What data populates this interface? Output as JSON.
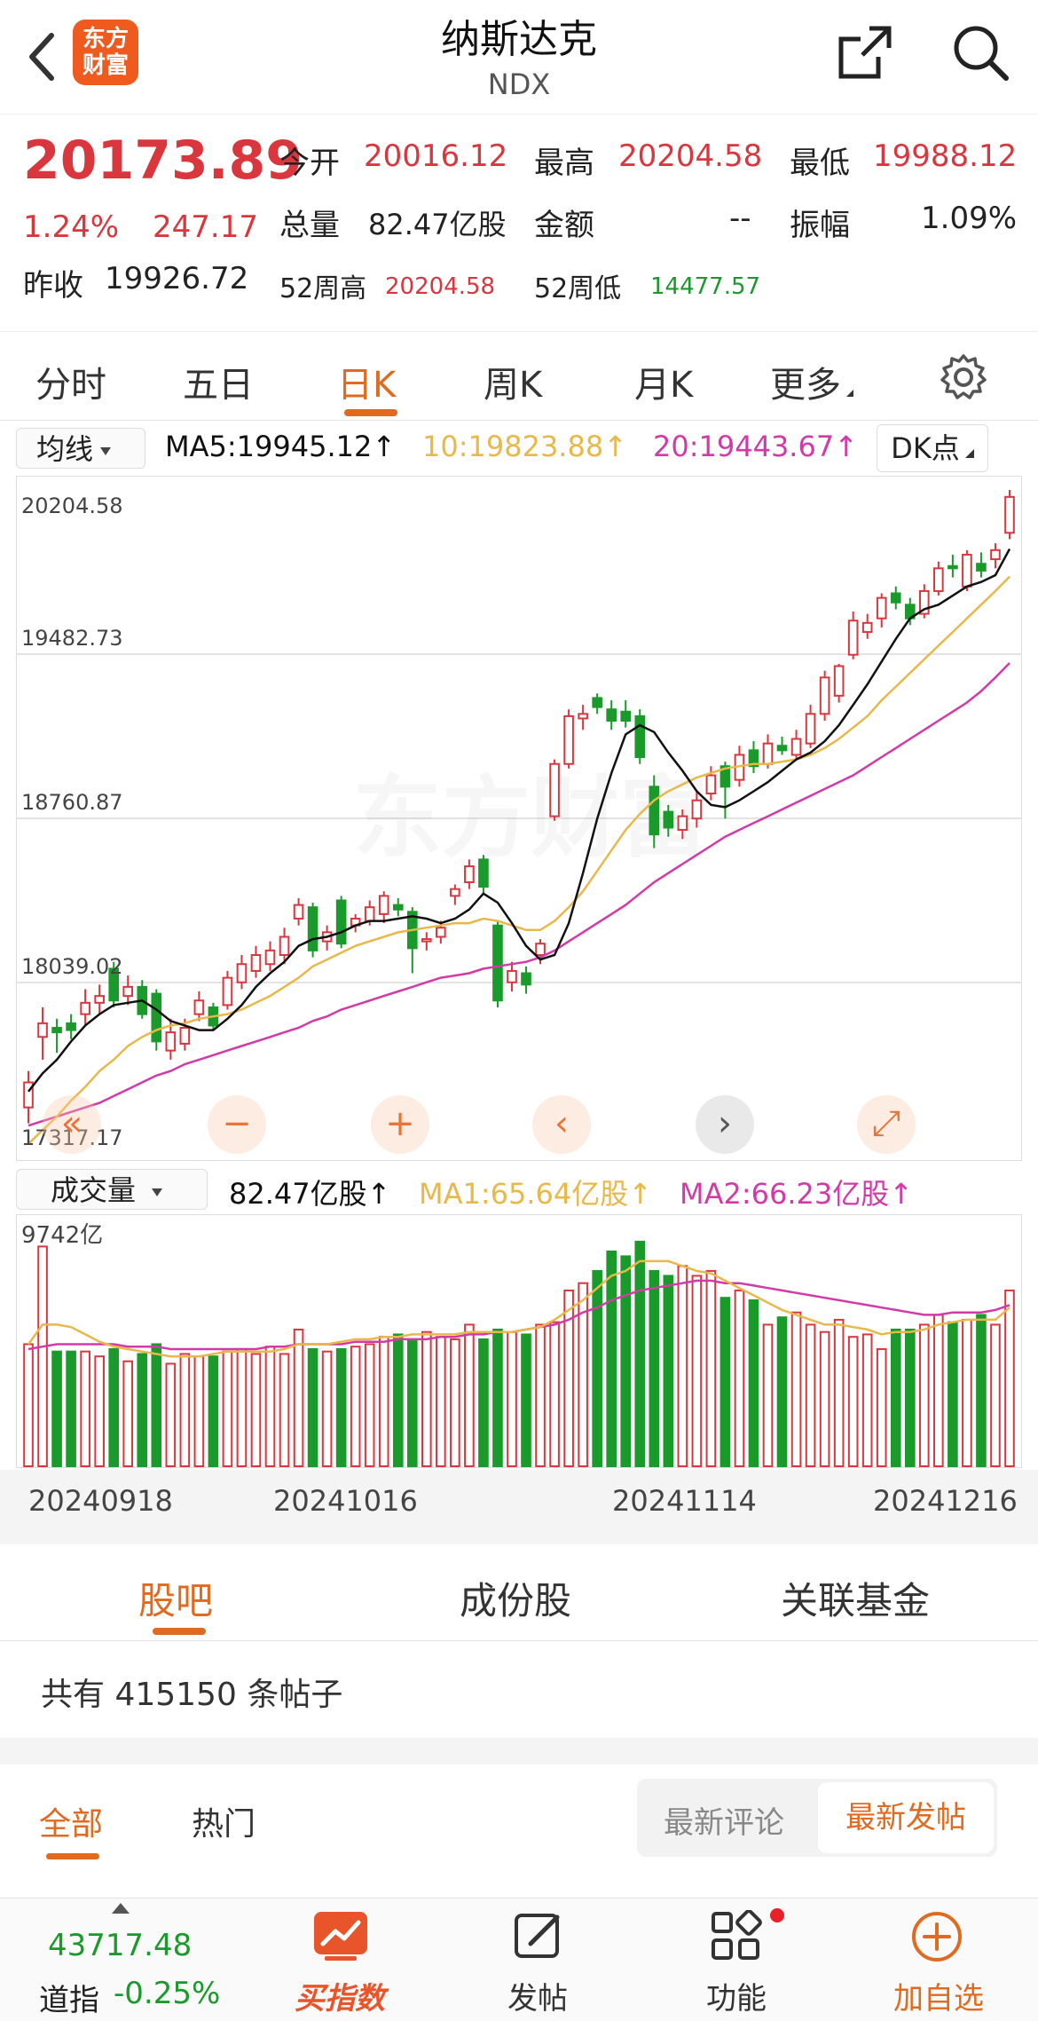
{
  "header": {
    "title": "纳斯达克",
    "code": "NDX",
    "logo_text_line1": "东方",
    "logo_text_line2": "财富"
  },
  "quote": {
    "price": "20173.89",
    "change_pct": "1.24%",
    "change_abs": "247.17",
    "open_label": "今开",
    "open": "20016.12",
    "high_label": "最高",
    "high": "20204.58",
    "low_label": "最低",
    "low": "19988.12",
    "volume_label": "总量",
    "volume": "82.47亿股",
    "amount_label": "金额",
    "amount": "--",
    "amplitude_label": "振幅",
    "amplitude": "1.09%",
    "prev_close_label": "昨收",
    "prev_close": "19926.72",
    "high52_label": "52周高",
    "high52": "20204.58",
    "low52_label": "52周低",
    "low52": "14477.57"
  },
  "period_tabs": [
    "分时",
    "五日",
    "日K",
    "周K",
    "月K",
    "更多"
  ],
  "active_period": "日K",
  "indicator_bar": {
    "selector": "均线",
    "ma5": "MA5:19945.12↑",
    "ma10": "10:19823.88↑",
    "ma20": "20:19443.67↑",
    "dk_button": "DK点"
  },
  "volume_bar": {
    "selector": "成交量",
    "volume": "82.47亿股↑",
    "ma1": "MA1:65.64亿股↑",
    "ma2": "MA2:66.23亿股↑"
  },
  "colors": {
    "up": "#d9363e",
    "down": "#1a9a2a",
    "ma5": "#111111",
    "ma10": "#e8b84a",
    "ma20": "#d23aa8",
    "accent": "#e06a1f"
  },
  "chart_data": {
    "type": "candlestick",
    "price_axis_ticks": [
      "20204.58",
      "19482.73",
      "18760.87",
      "18039.02",
      "17317.17"
    ],
    "ylim": [
      17317.17,
      20204.58
    ],
    "date_labels": [
      "20240918",
      "20241016",
      "20241114",
      "20241216"
    ],
    "volume_axis_max_label": "9742亿",
    "volume_max": 97.42,
    "watermark": "东方财富",
    "candles": [
      {
        "o": 17490,
        "c": 17600,
        "h": 17650,
        "l": 17420
      },
      {
        "o": 17800,
        "c": 17860,
        "h": 17930,
        "l": 17700
      },
      {
        "o": 17840,
        "c": 17820,
        "h": 17880,
        "l": 17730
      },
      {
        "o": 17860,
        "c": 17830,
        "h": 17900,
        "l": 17790
      },
      {
        "o": 17900,
        "c": 17950,
        "h": 18010,
        "l": 17850
      },
      {
        "o": 17950,
        "c": 17980,
        "h": 18030,
        "l": 17900
      },
      {
        "o": 18100,
        "c": 17960,
        "h": 18130,
        "l": 17930
      },
      {
        "o": 17980,
        "c": 18020,
        "h": 18070,
        "l": 17940
      },
      {
        "o": 18020,
        "c": 17900,
        "h": 18050,
        "l": 17880
      },
      {
        "o": 17990,
        "c": 17780,
        "h": 18010,
        "l": 17740
      },
      {
        "o": 17740,
        "c": 17820,
        "h": 17880,
        "l": 17700
      },
      {
        "o": 17770,
        "c": 17840,
        "h": 17880,
        "l": 17740
      },
      {
        "o": 17900,
        "c": 17960,
        "h": 18000,
        "l": 17870
      },
      {
        "o": 17930,
        "c": 17850,
        "h": 17950,
        "l": 17830
      },
      {
        "o": 17940,
        "c": 18060,
        "h": 18090,
        "l": 17920
      },
      {
        "o": 18040,
        "c": 18120,
        "h": 18160,
        "l": 18010
      },
      {
        "o": 18090,
        "c": 18160,
        "h": 18200,
        "l": 18060
      },
      {
        "o": 18120,
        "c": 18180,
        "h": 18220,
        "l": 18090
      },
      {
        "o": 18160,
        "c": 18240,
        "h": 18280,
        "l": 18120
      },
      {
        "o": 18320,
        "c": 18380,
        "h": 18410,
        "l": 18290
      },
      {
        "o": 18370,
        "c": 18180,
        "h": 18390,
        "l": 18150
      },
      {
        "o": 18220,
        "c": 18260,
        "h": 18290,
        "l": 18180
      },
      {
        "o": 18400,
        "c": 18210,
        "h": 18420,
        "l": 18190
      },
      {
        "o": 18290,
        "c": 18320,
        "h": 18340,
        "l": 18260
      },
      {
        "o": 18310,
        "c": 18370,
        "h": 18400,
        "l": 18290
      },
      {
        "o": 18340,
        "c": 18420,
        "h": 18440,
        "l": 18300
      },
      {
        "o": 18380,
        "c": 18360,
        "h": 18410,
        "l": 18330
      },
      {
        "o": 18350,
        "c": 18190,
        "h": 18370,
        "l": 18080
      },
      {
        "o": 18220,
        "c": 18230,
        "h": 18260,
        "l": 18180
      },
      {
        "o": 18240,
        "c": 18280,
        "h": 18310,
        "l": 18210
      },
      {
        "o": 18420,
        "c": 18450,
        "h": 18470,
        "l": 18380
      },
      {
        "o": 18480,
        "c": 18550,
        "h": 18580,
        "l": 18450
      },
      {
        "o": 18580,
        "c": 18460,
        "h": 18600,
        "l": 18430
      },
      {
        "o": 18290,
        "c": 17960,
        "h": 18310,
        "l": 17930
      },
      {
        "o": 18040,
        "c": 18090,
        "h": 18130,
        "l": 18000
      },
      {
        "o": 18080,
        "c": 18030,
        "h": 18110,
        "l": 17990
      },
      {
        "o": 18160,
        "c": 18210,
        "h": 18230,
        "l": 18120
      },
      {
        "o": 18770,
        "c": 19000,
        "h": 19020,
        "l": 18750
      },
      {
        "o": 19000,
        "c": 19210,
        "h": 19240,
        "l": 18980
      },
      {
        "o": 19200,
        "c": 19220,
        "h": 19260,
        "l": 19150
      },
      {
        "o": 19290,
        "c": 19250,
        "h": 19310,
        "l": 19220
      },
      {
        "o": 19240,
        "c": 19190,
        "h": 19280,
        "l": 19150
      },
      {
        "o": 19230,
        "c": 19190,
        "h": 19280,
        "l": 19160
      },
      {
        "o": 19210,
        "c": 19030,
        "h": 19240,
        "l": 19000
      },
      {
        "o": 18900,
        "c": 18690,
        "h": 18950,
        "l": 18630
      },
      {
        "o": 18790,
        "c": 18720,
        "h": 18820,
        "l": 18680
      },
      {
        "o": 18710,
        "c": 18770,
        "h": 18800,
        "l": 18670
      },
      {
        "o": 18760,
        "c": 18840,
        "h": 18880,
        "l": 18720
      },
      {
        "o": 18870,
        "c": 18950,
        "h": 18990,
        "l": 18840
      },
      {
        "o": 18990,
        "c": 18900,
        "h": 19010,
        "l": 18760
      },
      {
        "o": 18930,
        "c": 19040,
        "h": 19080,
        "l": 18900
      },
      {
        "o": 19060,
        "c": 18990,
        "h": 19100,
        "l": 18960
      },
      {
        "o": 19000,
        "c": 19090,
        "h": 19130,
        "l": 18980
      },
      {
        "o": 19080,
        "c": 19060,
        "h": 19120,
        "l": 19040
      },
      {
        "o": 19040,
        "c": 19110,
        "h": 19150,
        "l": 19020
      },
      {
        "o": 19090,
        "c": 19220,
        "h": 19260,
        "l": 19070
      },
      {
        "o": 19220,
        "c": 19380,
        "h": 19410,
        "l": 19190
      },
      {
        "o": 19300,
        "c": 19430,
        "h": 19440,
        "l": 19270
      },
      {
        "o": 19480,
        "c": 19630,
        "h": 19670,
        "l": 19460
      },
      {
        "o": 19580,
        "c": 19620,
        "h": 19660,
        "l": 19550
      },
      {
        "o": 19640,
        "c": 19730,
        "h": 19750,
        "l": 19600
      },
      {
        "o": 19750,
        "c": 19710,
        "h": 19780,
        "l": 19680
      },
      {
        "o": 19700,
        "c": 19640,
        "h": 19730,
        "l": 19610
      },
      {
        "o": 19660,
        "c": 19760,
        "h": 19790,
        "l": 19640
      },
      {
        "o": 19760,
        "c": 19860,
        "h": 19890,
        "l": 19740
      },
      {
        "o": 19870,
        "c": 19860,
        "h": 19920,
        "l": 19820
      },
      {
        "o": 19780,
        "c": 19920,
        "h": 19940,
        "l": 19760
      },
      {
        "o": 19880,
        "c": 19850,
        "h": 19930,
        "l": 19820
      },
      {
        "o": 19900,
        "c": 19940,
        "h": 19970,
        "l": 19860
      },
      {
        "o": 20016.12,
        "c": 20173.89,
        "h": 20204.58,
        "l": 19988.12
      }
    ],
    "ma5": [
      17560,
      17640,
      17700,
      17780,
      17850,
      17900,
      17940,
      17950,
      17960,
      17920,
      17870,
      17850,
      17830,
      17830,
      17880,
      17940,
      18020,
      18080,
      18130,
      18200,
      18230,
      18240,
      18260,
      18290,
      18310,
      18310,
      18320,
      18330,
      18320,
      18300,
      18320,
      18360,
      18430,
      18390,
      18300,
      18200,
      18140,
      18160,
      18300,
      18520,
      18760,
      18960,
      19130,
      19170,
      19140,
      19050,
      18970,
      18880,
      18820,
      18810,
      18840,
      18880,
      18920,
      18970,
      19020,
      19050,
      19100,
      19170,
      19260,
      19350,
      19450,
      19550,
      19640,
      19680,
      19700,
      19740,
      19780,
      19800,
      19830,
      19945.12
    ],
    "ma10": [
      17330,
      17390,
      17450,
      17520,
      17580,
      17650,
      17700,
      17760,
      17800,
      17830,
      17850,
      17860,
      17880,
      17890,
      17900,
      17920,
      17950,
      17980,
      18020,
      18060,
      18110,
      18140,
      18170,
      18200,
      18220,
      18240,
      18260,
      18270,
      18280,
      18290,
      18300,
      18300,
      18320,
      18310,
      18290,
      18270,
      18270,
      18310,
      18370,
      18440,
      18530,
      18620,
      18710,
      18780,
      18840,
      18880,
      18910,
      18940,
      18960,
      18980,
      18990,
      19000,
      19000,
      19010,
      19020,
      19040,
      19070,
      19110,
      19160,
      19210,
      19280,
      19340,
      19400,
      19460,
      19520,
      19580,
      19640,
      19700,
      19760,
      19823.88
    ],
    "ma20": [
      17410,
      17430,
      17450,
      17470,
      17490,
      17510,
      17540,
      17570,
      17600,
      17630,
      17650,
      17680,
      17700,
      17720,
      17740,
      17760,
      17780,
      17800,
      17820,
      17840,
      17870,
      17890,
      17920,
      17940,
      17960,
      17980,
      18000,
      18020,
      18040,
      18060,
      18070,
      18080,
      18100,
      18110,
      18120,
      18130,
      18150,
      18180,
      18220,
      18260,
      18300,
      18340,
      18380,
      18430,
      18480,
      18520,
      18560,
      18600,
      18640,
      18680,
      18710,
      18740,
      18770,
      18800,
      18830,
      18860,
      18890,
      18920,
      18950,
      18990,
      19030,
      19070,
      19110,
      19150,
      19190,
      19230,
      19270,
      19320,
      19380,
      19443.67
    ],
    "volume": [
      50,
      90,
      47,
      47,
      47,
      45,
      48,
      43,
      46,
      50,
      42,
      46,
      45,
      45,
      47,
      48,
      46,
      49,
      46,
      56,
      48,
      47,
      48,
      49,
      50,
      53,
      54,
      52,
      55,
      53,
      52,
      58,
      52,
      56,
      55,
      54,
      58,
      59,
      72,
      75,
      80,
      88,
      86,
      92,
      80,
      78,
      82,
      78,
      80,
      69,
      72,
      68,
      58,
      61,
      63,
      58,
      55,
      60,
      53,
      54,
      48,
      56,
      56,
      58,
      62,
      59,
      60,
      62,
      58,
      72
    ],
    "vol_ma1": [
      50,
      58,
      58,
      57,
      54,
      51,
      49,
      48,
      47,
      46,
      45,
      45,
      45,
      46,
      47,
      47,
      47,
      47,
      48,
      50,
      50,
      50,
      51,
      52,
      52,
      53,
      53,
      54,
      54,
      54,
      54,
      55,
      55,
      55,
      55,
      56,
      57,
      60,
      64,
      68,
      73,
      78,
      80,
      84,
      84,
      84,
      82,
      80,
      79,
      76,
      73,
      70,
      67,
      64,
      62,
      60,
      58,
      58,
      57,
      56,
      54,
      55,
      55,
      56,
      58,
      59,
      60,
      60,
      60,
      65
    ],
    "vol_ma2": [
      48,
      49,
      50,
      50,
      50,
      50,
      50,
      49,
      49,
      49,
      48,
      48,
      48,
      48,
      48,
      48,
      48,
      49,
      49,
      50,
      50,
      50,
      50,
      51,
      51,
      51,
      52,
      52,
      52,
      53,
      53,
      54,
      54,
      55,
      55,
      56,
      57,
      58,
      60,
      63,
      65,
      68,
      70,
      72,
      73,
      74,
      75,
      76,
      76,
      75,
      75,
      74,
      73,
      72,
      71,
      70,
      69,
      68,
      67,
      66,
      65,
      64,
      63,
      62,
      62,
      63,
      63,
      63,
      64,
      66
    ]
  },
  "zoom_controls": [
    "«",
    "−",
    "+",
    "‹",
    "›",
    "⤢"
  ],
  "community": {
    "tabs": [
      "股吧",
      "成份股",
      "关联基金"
    ],
    "active": "股吧",
    "post_count": "共有 415150 条帖子",
    "filters": [
      "全部",
      "热门"
    ],
    "sort_options": [
      "最新评论",
      "最新发帖"
    ]
  },
  "bottom_nav": {
    "ticker_value": "43717.48",
    "ticker_name": "道指",
    "ticker_change": "-0.25%",
    "items": [
      "买指数",
      "发帖",
      "功能",
      "加自选"
    ]
  }
}
